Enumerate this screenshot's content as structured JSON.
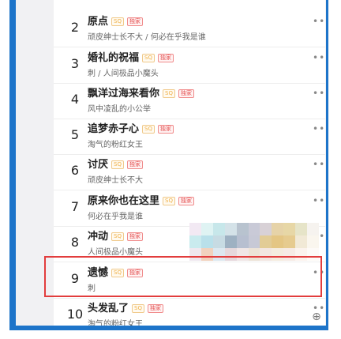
{
  "songs": [
    {
      "rank": "2",
      "title": "原点",
      "artist": "顽皮绅士长不大 / 何必在乎我是谁",
      "badges": [
        "SQ",
        "独家"
      ]
    },
    {
      "rank": "3",
      "title": "婚礼的祝福",
      "artist": "刺 / 人间极品小魔头",
      "badges": [
        "SQ",
        "独家"
      ]
    },
    {
      "rank": "4",
      "title": "飘洋过海来看你",
      "artist": "风中凌乱的小公举",
      "badges": [
        "SQ",
        "独家"
      ]
    },
    {
      "rank": "5",
      "title": "追梦赤子心",
      "artist": "淘气的粉红女王",
      "badges": [
        "SQ",
        "独家"
      ]
    },
    {
      "rank": "6",
      "title": "讨厌",
      "artist": "顽皮绅士长不大",
      "badges": [
        "SQ",
        "独家"
      ]
    },
    {
      "rank": "7",
      "title": "原来你也在这里",
      "artist": "何必在乎我是谁",
      "badges": [
        "SQ",
        "独家"
      ]
    },
    {
      "rank": "8",
      "title": "冲动",
      "artist": "人间极品小魔头",
      "badges": [
        "SQ",
        "独家"
      ]
    },
    {
      "rank": "9",
      "title": "遗憾",
      "artist": "刺",
      "badges": [
        "SQ",
        "独家"
      ]
    },
    {
      "rank": "10",
      "title": "头发乱了",
      "artist": "淘气的粉红女王",
      "badges": [
        "SQ",
        "独家"
      ]
    }
  ],
  "more_icon": "•••",
  "zoom_icon": "⊕",
  "colors": {
    "frame": "#1d74c9",
    "highlight": "#e23d3d"
  }
}
